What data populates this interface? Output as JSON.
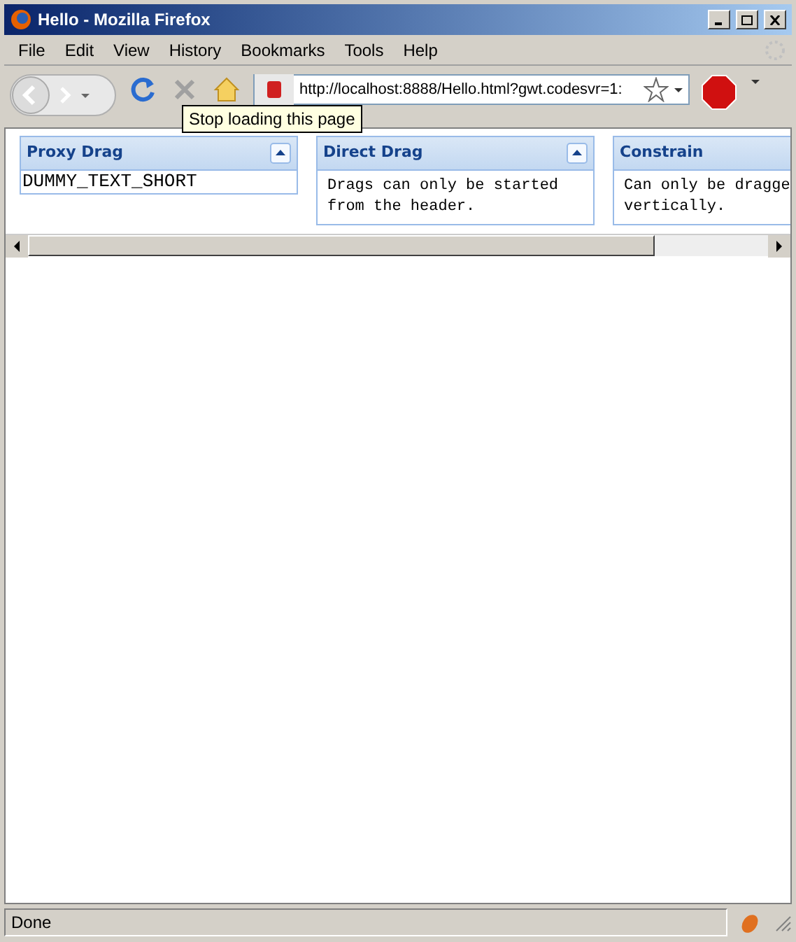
{
  "window": {
    "title": "Hello - Mozilla Firefox"
  },
  "menu": [
    "File",
    "Edit",
    "View",
    "History",
    "Bookmarks",
    "Tools",
    "Help"
  ],
  "address_bar": {
    "value": "http://localhost:8888/Hello.html?gwt.codesvr=1:"
  },
  "tooltip": "Stop loading this page",
  "panels": [
    {
      "title": "Proxy Drag",
      "collapsible": true,
      "kind": "plain",
      "body": "DUMMY_TEXT_SHORT"
    },
    {
      "title": "Direct Drag",
      "collapsible": true,
      "kind": "padded",
      "body": "Drags can only be started from the header."
    },
    {
      "title": "Constrain",
      "kind": "padded",
      "body": "Can only be dragge vertically."
    }
  ],
  "status_bar": {
    "text": "Done"
  }
}
